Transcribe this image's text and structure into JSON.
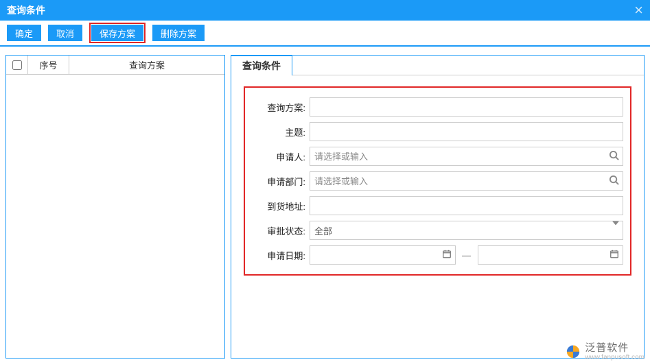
{
  "header": {
    "title": "查询条件"
  },
  "toolbar": {
    "ok": "确定",
    "cancel": "取消",
    "savePlan": "保存方案",
    "deletePlan": "删除方案"
  },
  "leftPanel": {
    "col_seq": "序号",
    "col_plan": "查询方案"
  },
  "rightPanel": {
    "tab": "查询条件",
    "labels": {
      "plan": "查询方案:",
      "subject": "主题:",
      "applicant": "申请人:",
      "dept": "申请部门:",
      "address": "到货地址:",
      "status": "审批状态:",
      "date": "申请日期:"
    },
    "placeholders": {
      "selectOrInput": "请选择或输入"
    },
    "values": {
      "plan": "",
      "subject": "",
      "applicant": "",
      "dept": "",
      "address": "",
      "status": "全部",
      "dateFrom": "",
      "dateTo": ""
    },
    "dateSep": "—"
  },
  "watermark": {
    "cn": "泛普软件",
    "en": "www.fanpusoft.com"
  }
}
